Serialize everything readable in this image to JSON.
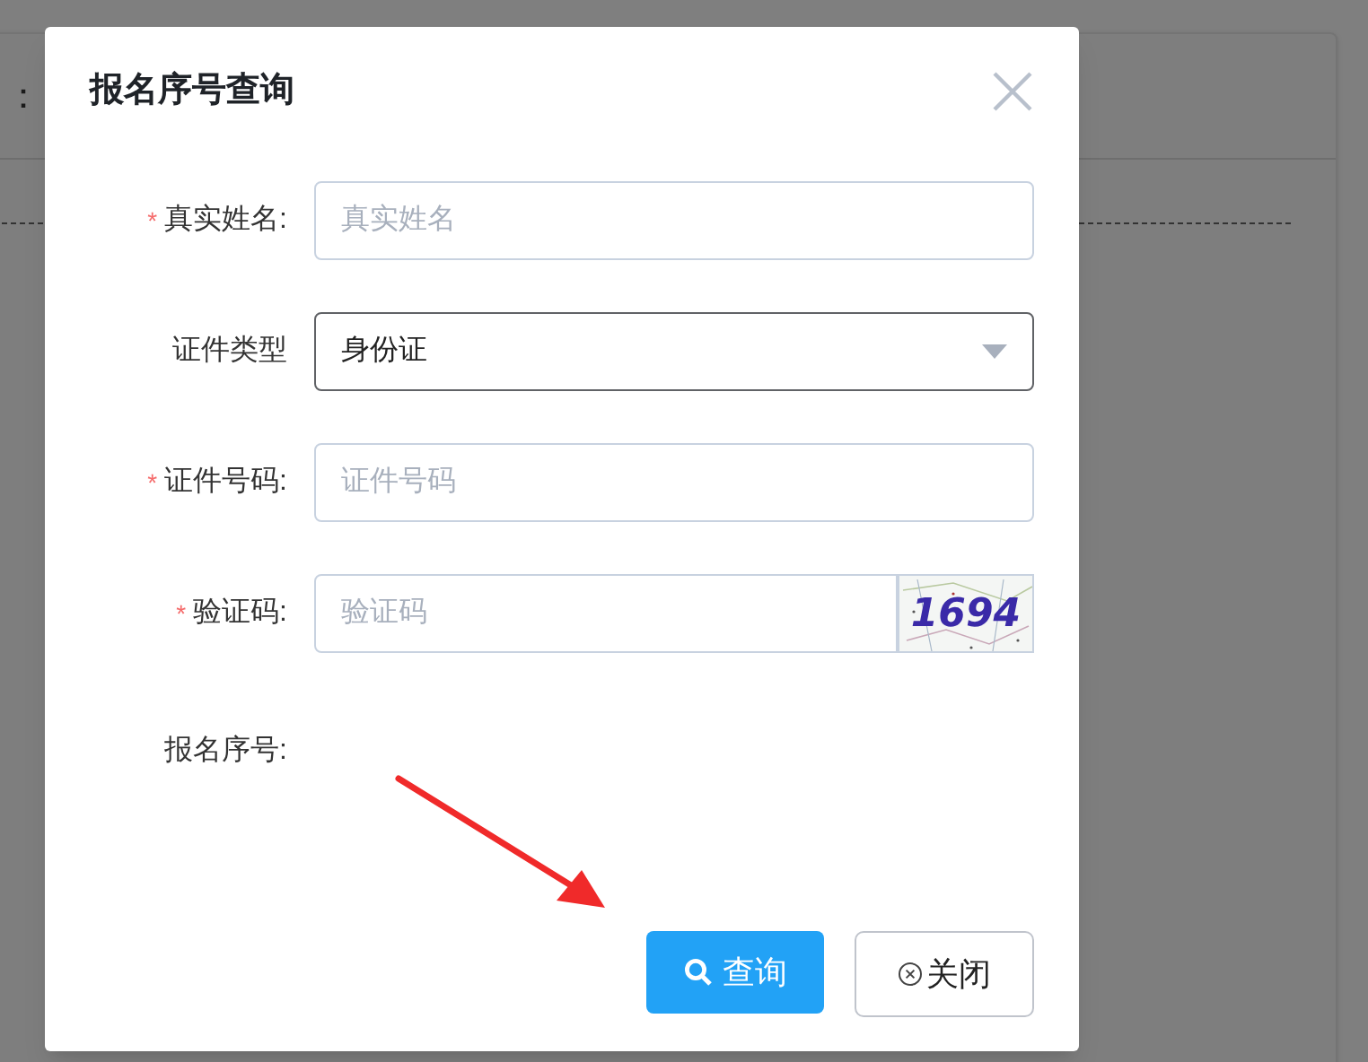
{
  "background": {
    "label": "："
  },
  "dialog": {
    "title": "报名序号查询",
    "fields": [
      {
        "kind": "text",
        "required_mark": "*",
        "label": "真实姓名:",
        "placeholder": "真实姓名"
      },
      {
        "kind": "select",
        "label": "证件类型",
        "value": "身份证"
      },
      {
        "kind": "text",
        "required_mark": "*",
        "label": "证件号码:",
        "placeholder": "证件号码"
      },
      {
        "kind": "captcha",
        "required_mark": "*",
        "label": "验证码:",
        "placeholder": "验证码",
        "captcha": "1694"
      },
      {
        "kind": "result",
        "label": "报名序号:"
      }
    ],
    "buttons": [
      {
        "kind": "primary",
        "label": "查询"
      },
      {
        "kind": "default",
        "label": "关闭"
      }
    ]
  }
}
